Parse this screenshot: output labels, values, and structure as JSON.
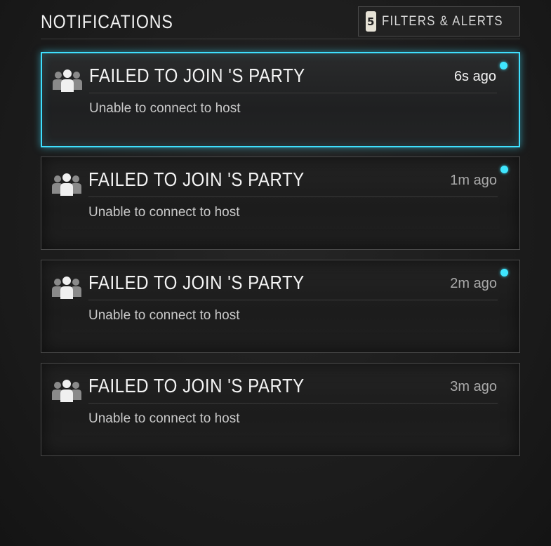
{
  "header": {
    "title": "NOTIFICATIONS",
    "filter_count": "5",
    "filters_label": "FILTERS & ALERTS"
  },
  "notifications": [
    {
      "title": "FAILED TO JOIN 'S PARTY",
      "time": "6s ago",
      "message": "Unable to connect to host",
      "icon": "party-icon",
      "unread": true,
      "selected": true
    },
    {
      "title": "FAILED TO JOIN 'S PARTY",
      "time": "1m ago",
      "message": "Unable to connect to host",
      "icon": "party-icon",
      "unread": true,
      "selected": false
    },
    {
      "title": "FAILED TO JOIN 'S PARTY",
      "time": "2m ago",
      "message": "Unable to connect to host",
      "icon": "party-icon",
      "unread": true,
      "selected": false
    },
    {
      "title": "FAILED TO JOIN 'S PARTY",
      "time": "3m ago",
      "message": "Unable to connect to host",
      "icon": "party-icon",
      "unread": false,
      "selected": false
    }
  ],
  "colors": {
    "accent": "#3fe6ff",
    "background": "#1c1c1c",
    "card_border": "#4a4a4a"
  }
}
